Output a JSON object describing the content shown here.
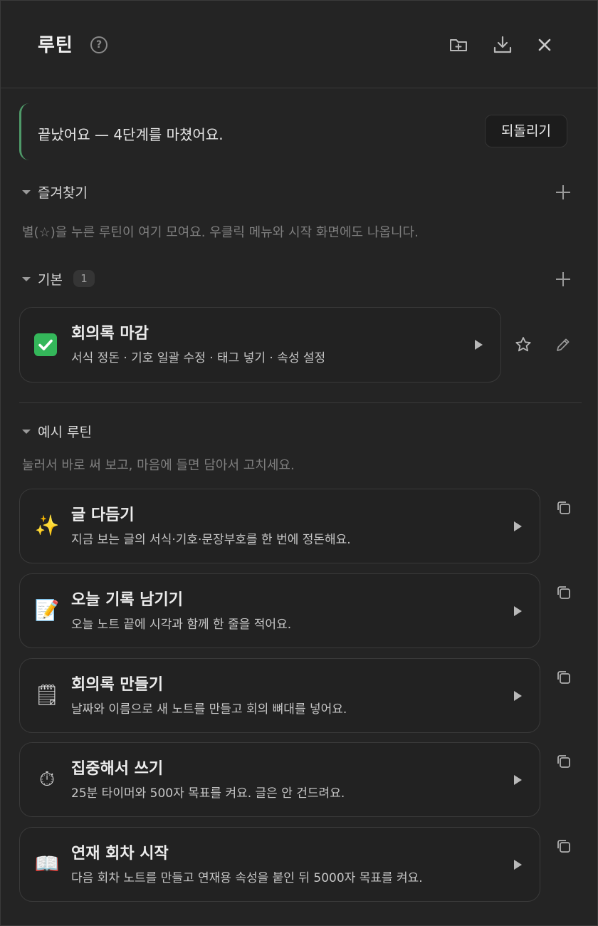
{
  "header": {
    "title": "루틴",
    "help_icon": "?"
  },
  "banner": {
    "message": "끝났어요 — 4단계를 마쳤어요.",
    "undo_label": "되돌리기"
  },
  "favorites": {
    "label": "즐겨찾기",
    "hint": "별(☆)을 누른 루틴이 여기 모여요. 우클릭 메뉴와 시작 화면에도 나옵니다."
  },
  "basic": {
    "label": "기본",
    "count": "1",
    "items": [
      {
        "icon": "check-mark-icon",
        "title": "회의록 마감",
        "subtitle": "서식 정돈 · 기호 일괄 수정 · 태그 넣기 · 속성 설정"
      }
    ]
  },
  "examples": {
    "label": "예시 루틴",
    "hint": "눌러서 바로 써 보고, 마음에 들면 담아서 고치세요.",
    "items": [
      {
        "emoji": "✨",
        "icon": "sparkles-icon",
        "title": "글 다듬기",
        "subtitle": "지금 보는 글의 서식·기호·문장부호를 한 번에 정돈해요."
      },
      {
        "emoji": "📝",
        "icon": "memo-icon",
        "title": "오늘 기록 남기기",
        "subtitle": "오늘 노트 끝에 시각과 함께 한 줄을 적어요."
      },
      {
        "emoji": "🗒",
        "icon": "notepad-icon",
        "title": "회의록 만들기",
        "subtitle": "날짜와 이름으로 새 노트를 만들고 회의 뼈대를 넣어요."
      },
      {
        "emoji": "⏱",
        "icon": "stopwatch-icon",
        "title": "집중해서 쓰기",
        "subtitle": "25분 타이머와 500자 목표를 켜요. 글은 안 건드려요."
      },
      {
        "emoji": "📖",
        "icon": "open-book-icon",
        "title": "연재 회차 시작",
        "subtitle": "다음 회차 노트를 만들고 연재용 속성을 붙인 뒤 5000자 목표를 켜요."
      }
    ]
  },
  "colors": {
    "accent_green": "#4f9a69",
    "check_green": "#34b75a",
    "panel_bg": "#242424"
  }
}
